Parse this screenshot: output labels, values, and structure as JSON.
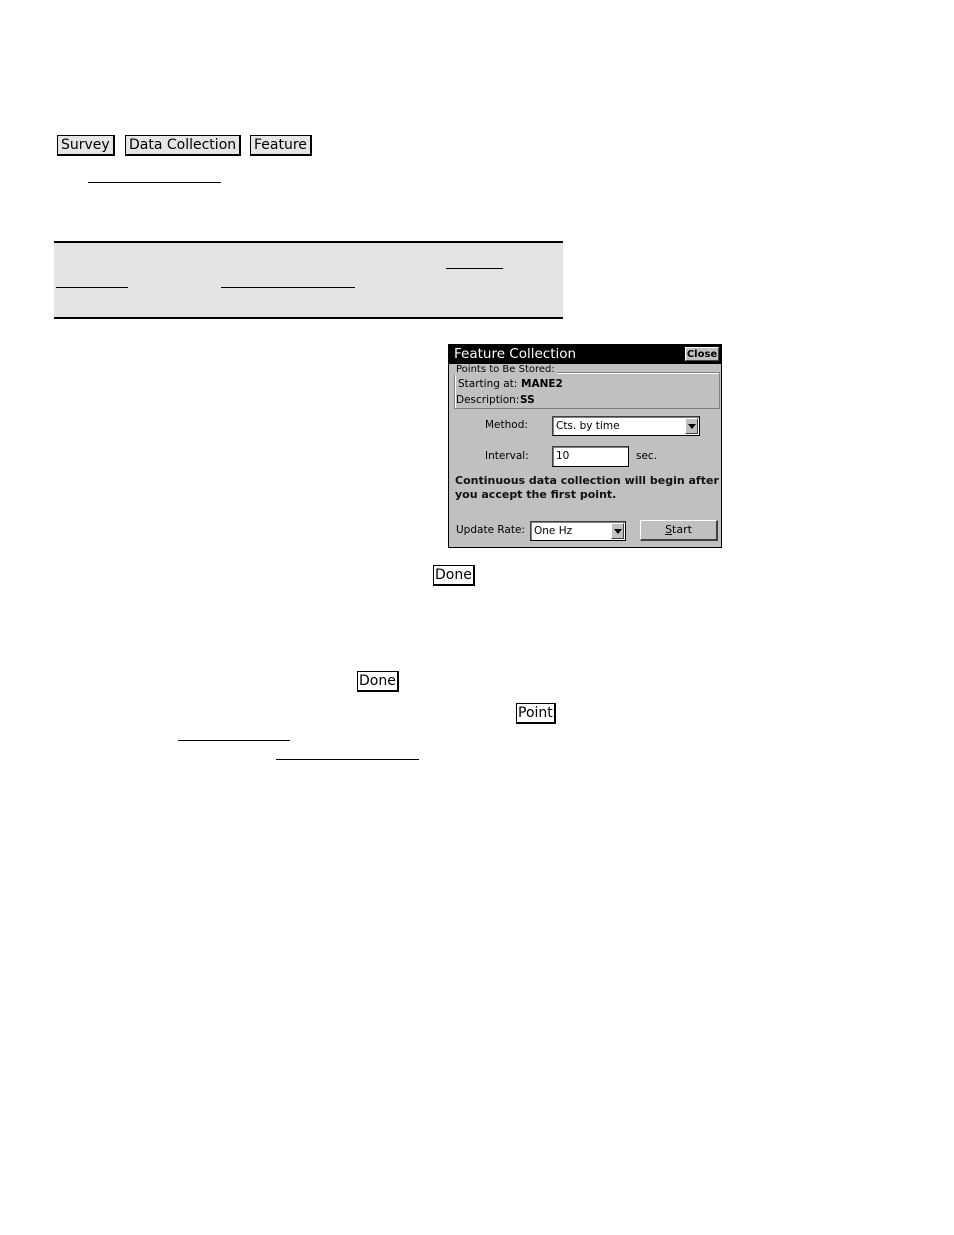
{
  "menu_path": {
    "keys": [
      "Survey",
      "Data Collection",
      "Feature"
    ]
  },
  "dialog": {
    "title": "Feature Collection",
    "close_label": "Close",
    "group_label": "Points to Be Stored:",
    "starting_at_label": "Starting at:",
    "starting_at_value": "MANE2",
    "description_label": "Description:",
    "description_value": "SS",
    "method_label": "Method:",
    "method_value": "Cts. by time",
    "interval_label": "Interval:",
    "interval_value": "10",
    "interval_unit": "sec.",
    "message": "Continuous data collection will begin after you accept the first point.",
    "update_rate_label": "Update Rate:",
    "update_rate_value": "One Hz",
    "start_label_prefix": "",
    "start_label_accel": "S",
    "start_label_rest": "tart"
  },
  "inline_keys": {
    "done_1": "Done",
    "done_2": "Done",
    "point": "Point"
  }
}
